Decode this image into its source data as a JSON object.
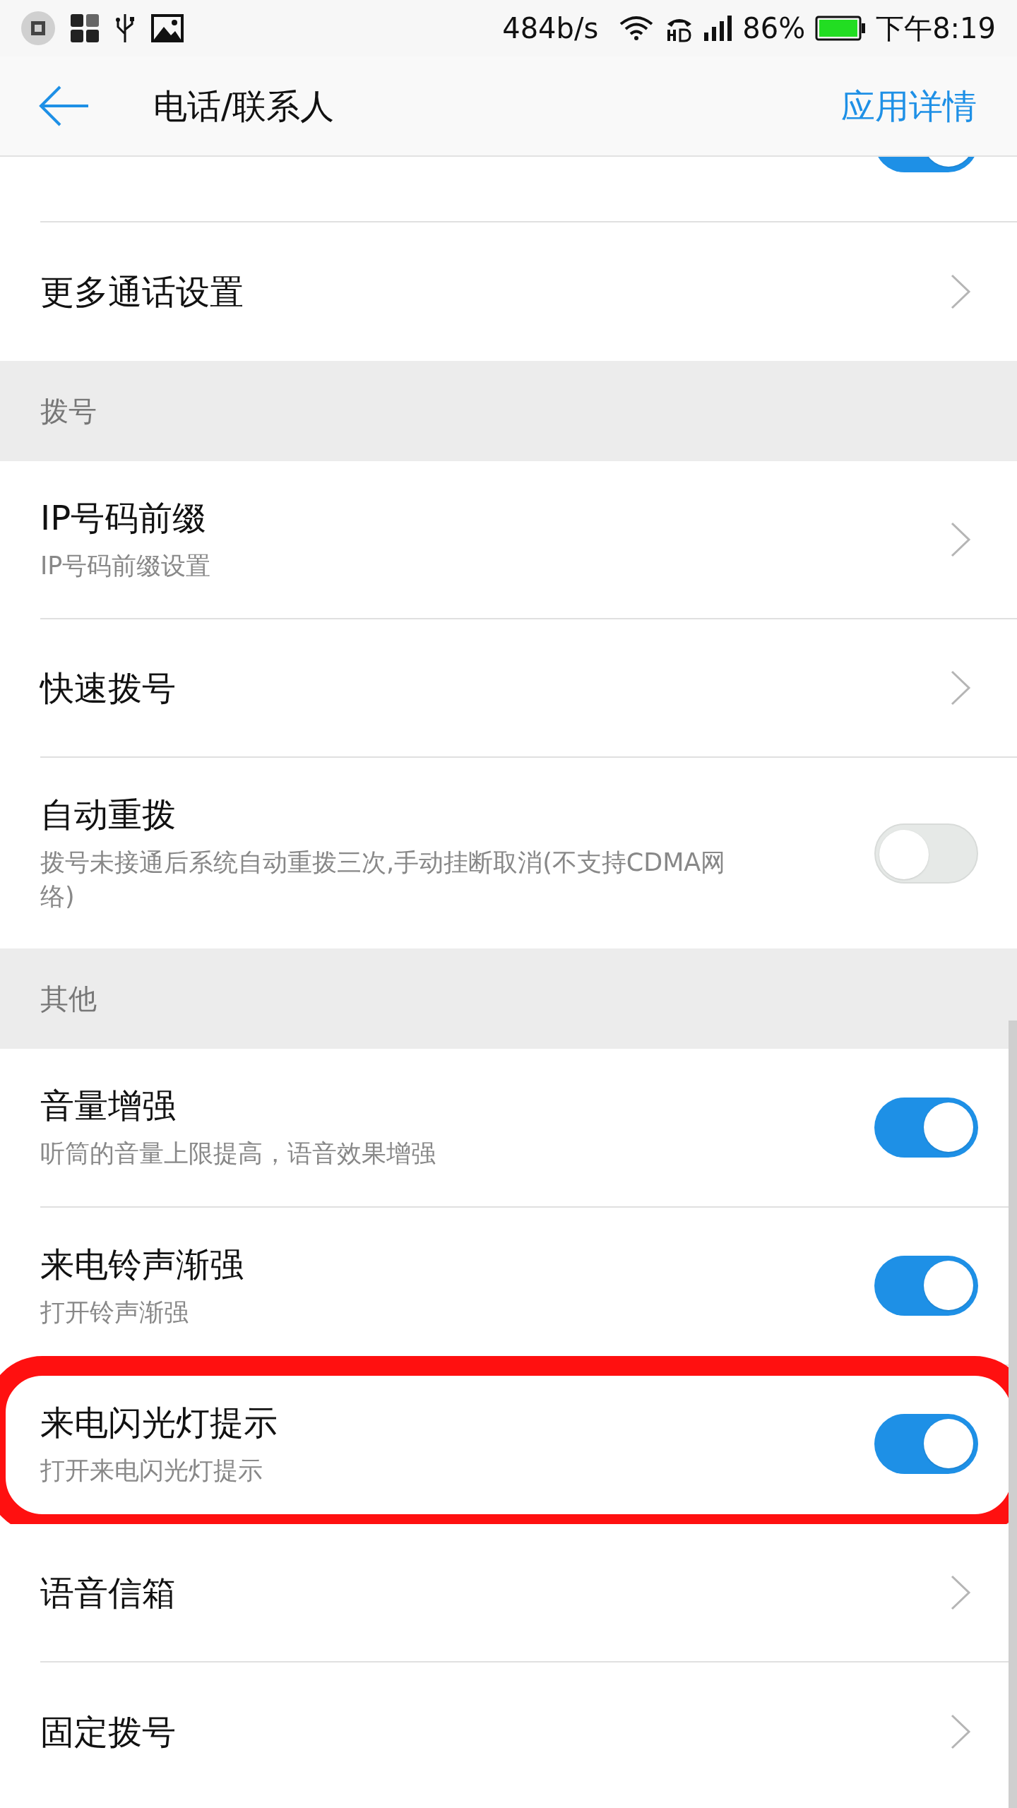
{
  "status_bar": {
    "speed": "484b/s",
    "battery": "86%",
    "time": "下午8:19"
  },
  "header": {
    "title": "电话/联系人",
    "action": "应用详情"
  },
  "settings": [
    {
      "kind": "toggle",
      "on": true,
      "cut": true
    },
    {
      "kind": "link",
      "title": "更多通话设置"
    },
    {
      "kind": "section",
      "title": "拨号"
    },
    {
      "kind": "link",
      "title": "IP号码前缀",
      "subtitle": "IP号码前缀设置"
    },
    {
      "kind": "link",
      "title": "快速拨号"
    },
    {
      "kind": "toggle",
      "title": "自动重拨",
      "subtitle": "拨号未接通后系统自动重拨三次,手动挂断取消(不支持CDMA网络)",
      "on": false
    },
    {
      "kind": "section",
      "title": "其他"
    },
    {
      "kind": "toggle",
      "title": "音量增强",
      "subtitle": "听筒的音量上限提高，语音效果增强",
      "on": true
    },
    {
      "kind": "toggle",
      "title": "来电铃声渐强",
      "subtitle": "打开铃声渐强",
      "on": true
    },
    {
      "kind": "toggle",
      "title": "来电闪光灯提示",
      "subtitle": "打开来电闪光灯提示",
      "on": true,
      "highlighted": true
    },
    {
      "kind": "link",
      "title": "语音信箱"
    },
    {
      "kind": "link",
      "title": "固定拨号"
    }
  ]
}
